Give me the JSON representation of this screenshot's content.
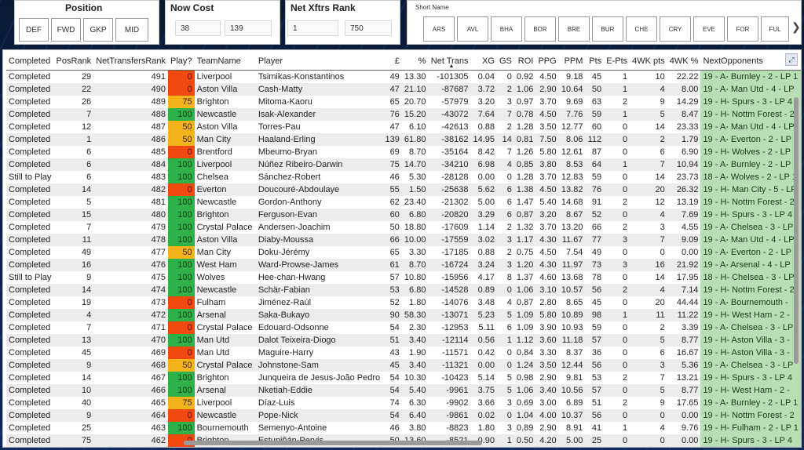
{
  "position": {
    "title": "Position",
    "buttons": [
      "DEF",
      "FWD",
      "GKP",
      "MID"
    ]
  },
  "now_cost": {
    "title": "Now Cost",
    "min": "38",
    "max": "139"
  },
  "net_xftrs": {
    "title": "Net Xftrs Rank",
    "min": "1",
    "max": "750"
  },
  "short_name": {
    "title": "Short Name",
    "buttons": [
      "ARS",
      "AVL",
      "BHA",
      "BOR",
      "BRE",
      "BUR",
      "CHE",
      "CRY",
      "EVE",
      "FOR",
      "FUL"
    ],
    "next_arrow": "❯"
  },
  "table": {
    "columns": [
      "Completed",
      "PosRank",
      "NetTransfersRank",
      "Play?",
      "TeamName",
      "Player",
      "£",
      "%",
      "Net Trans",
      "XG",
      "GS",
      "ROI",
      "PPG",
      "PPM",
      "Pts",
      "E-Pts",
      "4WK pts",
      "4WK %",
      "NextOpponents"
    ],
    "sort_indicator": "▲",
    "rows": [
      [
        "Completed",
        "29",
        "491",
        "0",
        "Liverpool",
        "Tsimikas-Konstantinos",
        "49",
        "13.30",
        "-101305",
        "0.04",
        "0",
        "0.92",
        "4.50",
        "9.18",
        "45",
        "1",
        "10",
        "22.22",
        "19 - A- Burnley - 2 - LP 1"
      ],
      [
        "Completed",
        "22",
        "490",
        "0",
        "Aston Villa",
        "Cash-Matty",
        "47",
        "21.10",
        "-87687",
        "3.72",
        "2",
        "1.06",
        "2.90",
        "10.64",
        "50",
        "1",
        "4",
        "8.00",
        "19 - A- Man Utd - 4 - LP"
      ],
      [
        "Completed",
        "26",
        "489",
        "75",
        "Brighton",
        "Mitoma-Kaoru",
        "65",
        "20.70",
        "-57979",
        "3.20",
        "3",
        "0.97",
        "3.70",
        "9.69",
        "63",
        "2",
        "9",
        "14.29",
        "19 - H- Spurs - 3 - LP 4"
      ],
      [
        "Completed",
        "7",
        "488",
        "100",
        "Newcastle",
        "Isak-Alexander",
        "76",
        "15.20",
        "-43072",
        "7.64",
        "7",
        "0.78",
        "4.50",
        "7.76",
        "59",
        "1",
        "5",
        "8.47",
        "19 - H- Nottm Forest - 2"
      ],
      [
        "Completed",
        "12",
        "487",
        "50",
        "Aston Villa",
        "Torres-Pau",
        "47",
        "6.10",
        "-42613",
        "0.88",
        "2",
        "1.28",
        "3.50",
        "12.77",
        "60",
        "0",
        "14",
        "23.33",
        "19 - A- Man Utd - 4 - LP"
      ],
      [
        "Completed",
        "1",
        "486",
        "50",
        "Man City",
        "Haaland-Erling",
        "139",
        "61.80",
        "-38162",
        "14.95",
        "14",
        "0.81",
        "7.50",
        "8.06",
        "112",
        "0",
        "2",
        "1.79",
        "19 - A- Everton - 2 - LP"
      ],
      [
        "Completed",
        "6",
        "485",
        "0",
        "Brentford",
        "Mbeumo-Bryan",
        "69",
        "8.70",
        "-35164",
        "8.42",
        "7",
        "1.26",
        "5.80",
        "12.61",
        "87",
        "0",
        "6",
        "6.90",
        "19 - H- Wolves - 2 - LP 1"
      ],
      [
        "Completed",
        "6",
        "484",
        "100",
        "Liverpool",
        "Núñez Ribeiro-Darwin",
        "75",
        "14.70",
        "-34210",
        "6.98",
        "4",
        "0.85",
        "3.80",
        "8.53",
        "64",
        "1",
        "7",
        "10.94",
        "19 - A- Burnley - 2 - LP 1"
      ],
      [
        "Still to Play",
        "6",
        "483",
        "100",
        "Chelsea",
        "Sánchez-Robert",
        "46",
        "5.30",
        "-28128",
        "0.00",
        "0",
        "1.28",
        "3.70",
        "12.83",
        "59",
        "0",
        "14",
        "23.73",
        "18 - A- Wolves - 2 - LP 1"
      ],
      [
        "Completed",
        "14",
        "482",
        "0",
        "Everton",
        "Doucouré-Abdoulaye",
        "55",
        "1.50",
        "-25638",
        "5.62",
        "6",
        "1.38",
        "4.50",
        "13.82",
        "76",
        "0",
        "20",
        "26.32",
        "19 - H- Man City - 5 - LP"
      ],
      [
        "Completed",
        "5",
        "481",
        "100",
        "Newcastle",
        "Gordon-Anthony",
        "62",
        "23.40",
        "-21302",
        "5.00",
        "6",
        "1.47",
        "5.40",
        "14.68",
        "91",
        "2",
        "12",
        "13.19",
        "19 - H- Nottm Forest - 2"
      ],
      [
        "Completed",
        "15",
        "480",
        "100",
        "Brighton",
        "Ferguson-Evan",
        "60",
        "6.80",
        "-20820",
        "3.29",
        "6",
        "0.87",
        "3.20",
        "8.67",
        "52",
        "0",
        "4",
        "7.69",
        "19 - H- Spurs - 3 - LP 4"
      ],
      [
        "Completed",
        "7",
        "479",
        "100",
        "Crystal Palace",
        "Andersen-Joachim",
        "50",
        "18.80",
        "-17609",
        "1.14",
        "2",
        "1.32",
        "3.70",
        "13.20",
        "66",
        "2",
        "3",
        "4.55",
        "19 - A- Chelsea - 3 - LP"
      ],
      [
        "Completed",
        "11",
        "478",
        "100",
        "Aston Villa",
        "Diaby-Moussa",
        "66",
        "10.00",
        "-17559",
        "3.02",
        "3",
        "1.17",
        "4.30",
        "11.67",
        "77",
        "3",
        "7",
        "9.09",
        "19 - A- Man Utd - 4 - LP"
      ],
      [
        "Completed",
        "49",
        "477",
        "50",
        "Man City",
        "Doku-Jérémy",
        "65",
        "3.30",
        "-17185",
        "0.88",
        "2",
        "0.75",
        "4.50",
        "7.54",
        "49",
        "0",
        "0",
        "0.00",
        "19 - A- Everton - 2 - LP"
      ],
      [
        "Completed",
        "16",
        "476",
        "100",
        "West Ham",
        "Ward-Prowse-James",
        "61",
        "8.70",
        "-16724",
        "3.24",
        "3",
        "1.20",
        "4.30",
        "11.97",
        "73",
        "3",
        "16",
        "21.92",
        "19 - A- Arsenal - 4 - LP"
      ],
      [
        "Still to Play",
        "9",
        "475",
        "100",
        "Wolves",
        "Hee-chan-Hwang",
        "57",
        "10.80",
        "-15956",
        "4.17",
        "8",
        "1.37",
        "4.60",
        "13.68",
        "78",
        "0",
        "14",
        "17.95",
        "18 - H- Chelsea - 3 - LP"
      ],
      [
        "Completed",
        "14",
        "474",
        "100",
        "Newcastle",
        "Schär-Fabian",
        "53",
        "6.80",
        "-14528",
        "0.89",
        "0",
        "1.06",
        "3.10",
        "10.57",
        "56",
        "2",
        "4",
        "7.14",
        "19 - H- Nottm Forest - 2"
      ],
      [
        "Completed",
        "19",
        "473",
        "0",
        "Fulham",
        "Jiménez-Raúl",
        "52",
        "1.80",
        "-14076",
        "3.48",
        "4",
        "0.87",
        "2.80",
        "8.65",
        "45",
        "0",
        "20",
        "44.44",
        "19 - A- Bournemouth -"
      ],
      [
        "Completed",
        "4",
        "472",
        "100",
        "Arsenal",
        "Saka-Bukayo",
        "90",
        "58.30",
        "-13071",
        "5.23",
        "5",
        "1.09",
        "5.80",
        "10.89",
        "98",
        "1",
        "11",
        "11.22",
        "19 - H- West Ham - 2 -"
      ],
      [
        "Completed",
        "7",
        "471",
        "0",
        "Crystal Palace",
        "Edouard-Odsonne",
        "54",
        "2.30",
        "-12953",
        "5.11",
        "6",
        "1.09",
        "3.90",
        "10.93",
        "59",
        "0",
        "2",
        "3.39",
        "19 - A- Chelsea - 3 - LP"
      ],
      [
        "Completed",
        "13",
        "470",
        "100",
        "Man Utd",
        "Dalot Teixeira-Diogo",
        "51",
        "3.40",
        "-12114",
        "0.56",
        "1",
        "1.12",
        "3.60",
        "11.18",
        "57",
        "0",
        "5",
        "8.77",
        "19 - H- Aston Villa - 3 -"
      ],
      [
        "Completed",
        "45",
        "469",
        "0",
        "Man Utd",
        "Maguire-Harry",
        "43",
        "1.90",
        "-11571",
        "0.42",
        "0",
        "0.84",
        "3.30",
        "8.37",
        "36",
        "0",
        "6",
        "16.67",
        "19 - H- Aston Villa - 3 -"
      ],
      [
        "Completed",
        "9",
        "468",
        "50",
        "Crystal Palace",
        "Johnstone-Sam",
        "45",
        "3.40",
        "-11321",
        "0.00",
        "0",
        "1.24",
        "3.50",
        "12.44",
        "56",
        "0",
        "3",
        "5.36",
        "19 - A- Chelsea - 3 - LP"
      ],
      [
        "Completed",
        "14",
        "467",
        "100",
        "Brighton",
        "Junqueira de Jesus-João Pedro",
        "54",
        "10.30",
        "-10423",
        "5.14",
        "5",
        "0.98",
        "2.90",
        "9.81",
        "53",
        "2",
        "7",
        "13.21",
        "19 - H- Spurs - 3 - LP 4"
      ],
      [
        "Completed",
        "10",
        "466",
        "100",
        "Arsenal",
        "Nketiah-Eddie",
        "54",
        "5.40",
        "-9961",
        "3.75",
        "5",
        "1.06",
        "3.40",
        "10.56",
        "57",
        "0",
        "5",
        "8.77",
        "19 - H- West Ham - 2 -"
      ],
      [
        "Completed",
        "40",
        "465",
        "75",
        "Liverpool",
        "Díaz-Luis",
        "74",
        "6.30",
        "-9902",
        "3.66",
        "3",
        "0.69",
        "3.00",
        "6.89",
        "51",
        "2",
        "9",
        "17.65",
        "19 - A- Burnley - 2 - LP 1"
      ],
      [
        "Completed",
        "9",
        "464",
        "0",
        "Newcastle",
        "Pope-Nick",
        "54",
        "6.40",
        "-9861",
        "0.02",
        "0",
        "1.04",
        "4.00",
        "10.37",
        "56",
        "0",
        "0",
        "0.00",
        "19 - H- Nottm Forest - 2"
      ],
      [
        "Completed",
        "25",
        "463",
        "100",
        "Bournemouth",
        "Semenyo-Antoine",
        "46",
        "3.80",
        "-8823",
        "1.80",
        "3",
        "0.89",
        "2.90",
        "8.91",
        "41",
        "1",
        "4",
        "9.76",
        "19 - H- Fulham - 2 - LP 1"
      ],
      [
        "Completed",
        "75",
        "462",
        "0",
        "Brighton",
        "Estupiñán-Pervis",
        "50",
        "13.60",
        "-8521",
        "0.90",
        "1",
        "0.50",
        "4.20",
        "5.00",
        "25",
        "0",
        "0",
        "0.00",
        "19 - H- Spurs - 3 - LP 4"
      ]
    ]
  },
  "colors": {
    "play_0": "#f0480f",
    "play_50": "#f5b31b",
    "play_75": "#f5b31b",
    "play_100": "#2fb14a",
    "next_opp_bg": "#b7deb4"
  }
}
